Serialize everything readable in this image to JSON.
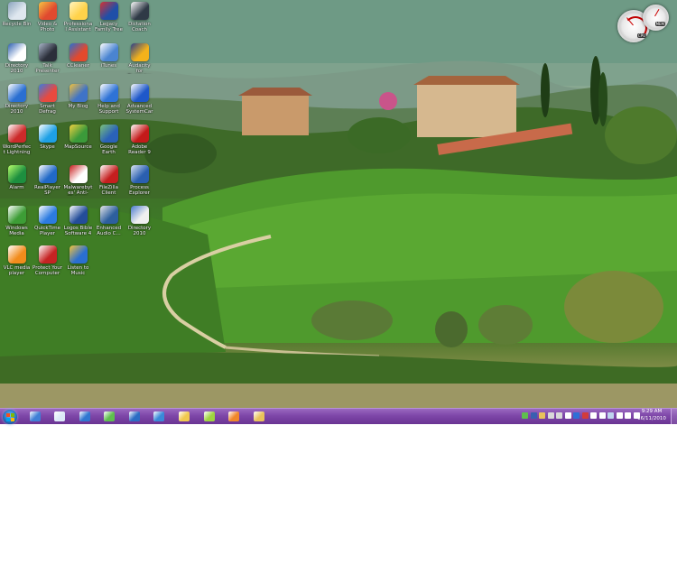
{
  "desktop": {
    "icons": [
      {
        "label": "Recycle Bin",
        "icon": "recycle-bin-icon",
        "color": "#dfe7ef",
        "accent": "#8aa3bd"
      },
      {
        "label": "Video & Photo",
        "icon": "media-icon",
        "color": "#e04a2f",
        "accent": "#f6c343"
      },
      {
        "label": "Professional Assistant",
        "icon": "professional-icon",
        "color": "#ffd24a",
        "accent": "#fff4c2"
      },
      {
        "label": "Legacy Family Tree",
        "icon": "legacy-icon",
        "color": "#1f4fa8",
        "accent": "#d43333"
      },
      {
        "label": "Dictation Coach",
        "icon": "dictation-icon",
        "color": "#2f3a46",
        "accent": "#ffffff"
      },
      {
        "label": "Directory 2010",
        "icon": "directory-doc-icon",
        "color": "#ffffff",
        "accent": "#2d5fb0"
      },
      {
        "label": "Talk Presenter",
        "icon": "talk-icon",
        "color": "#2b2f3a",
        "accent": "#a9b5c9"
      },
      {
        "label": "CCleaner",
        "icon": "ccleaner-icon",
        "color": "#e2492d",
        "accent": "#2a6fd1"
      },
      {
        "label": "iTunes",
        "icon": "itunes-icon",
        "color": "#4a84d1",
        "accent": "#ffffff"
      },
      {
        "label": "Audacity for Dummies",
        "icon": "audacity-icon",
        "color": "#f3b21b",
        "accent": "#2b3f8a"
      },
      {
        "label": "Directory 2010",
        "icon": "directory-pen-icon",
        "color": "#2a6fd1",
        "accent": "#ffffff"
      },
      {
        "label": "Smart Defrag",
        "icon": "defrag-icon",
        "color": "#e84a3f",
        "accent": "#3b7be0"
      },
      {
        "label": "My Blog",
        "icon": "blog-icon",
        "color": "#3f73c7",
        "accent": "#f2c13b"
      },
      {
        "label": "Help and Support",
        "icon": "help-icon",
        "color": "#2f73d6",
        "accent": "#ffffff"
      },
      {
        "label": "Advanced SystemCare",
        "icon": "systemcare-icon",
        "color": "#1e58c9",
        "accent": "#ffffff"
      },
      {
        "label": "WordPerfect Lightning",
        "icon": "wordperfect-icon",
        "color": "#cc2a2a",
        "accent": "#ffffff"
      },
      {
        "label": "Skype",
        "icon": "skype-icon",
        "color": "#1ea0e6",
        "accent": "#ffffff"
      },
      {
        "label": "MapSource",
        "icon": "mapsource-icon",
        "color": "#3b9a3a",
        "accent": "#f0d040"
      },
      {
        "label": "Google Earth",
        "icon": "google-earth-icon",
        "color": "#2a62b8",
        "accent": "#7cc17a"
      },
      {
        "label": "Adobe Reader 9",
        "icon": "adobe-reader-icon",
        "color": "#c41a1a",
        "accent": "#ffffff"
      },
      {
        "label": "Alarm",
        "icon": "alarm-icon",
        "color": "#1d8f3f",
        "accent": "#b8ff6b"
      },
      {
        "label": "RealPlayer SP",
        "icon": "realplayer-icon",
        "color": "#2169c7",
        "accent": "#ffffff"
      },
      {
        "label": "Malwarebytes' Anti-Malware",
        "icon": "malwarebytes-icon",
        "color": "#ffffff",
        "accent": "#c91d1d"
      },
      {
        "label": "FileZilla Client",
        "icon": "filezilla-icon",
        "color": "#c51f1f",
        "accent": "#ffffff"
      },
      {
        "label": "Process Explorer",
        "icon": "tools-icon",
        "color": "#2a5fb0",
        "accent": "#dde6f2"
      },
      {
        "label": "Windows Media Center",
        "icon": "media-center-icon",
        "color": "#3d9d36",
        "accent": "#ffffff"
      },
      {
        "label": "QuickTime Player",
        "icon": "quicktime-icon",
        "color": "#2c7be0",
        "accent": "#ffffff"
      },
      {
        "label": "Logos Bible Software 4",
        "icon": "logos-icon",
        "color": "#244d9a",
        "accent": "#ffffff"
      },
      {
        "label": "Enhanced Audio C...",
        "icon": "audio-icon",
        "color": "#2d5f9e",
        "accent": "#e8e8e8"
      },
      {
        "label": "Directory 2010",
        "icon": "notes-doc-icon",
        "color": "#f0f0f0",
        "accent": "#4a7acf"
      },
      {
        "label": "VLC media player",
        "icon": "vlc-icon",
        "color": "#f28c1c",
        "accent": "#ffffff"
      },
      {
        "label": "Protect Your Computer",
        "icon": "shield-icon",
        "color": "#c62323",
        "accent": "#ffffff"
      },
      {
        "label": "Listen to Music",
        "icon": "music-icon",
        "color": "#2a6fd1",
        "accent": "#f4c43a"
      }
    ]
  },
  "gadgets": {
    "cpu_label": "CPU",
    "mem_label": "MEM"
  },
  "taskbar": {
    "color": "#7e47a8",
    "pinned": [
      {
        "icon": "explorer-icon",
        "color": "#3f7fd6"
      },
      {
        "icon": "notepad-icon",
        "color": "#dce9f7"
      },
      {
        "icon": "internet-explorer-icon",
        "color": "#2f77d1"
      },
      {
        "icon": "paint-icon",
        "color": "#5fbf4e"
      },
      {
        "icon": "magnifier-icon",
        "color": "#2b6cc4"
      },
      {
        "icon": "word-pen-icon",
        "color": "#3a8ad9"
      },
      {
        "icon": "folder-icon",
        "color": "#f1c94e"
      },
      {
        "icon": "green-app-icon",
        "color": "#9fd43f"
      },
      {
        "icon": "media-player-icon",
        "color": "#f0872a"
      },
      {
        "icon": "libraries-icon",
        "color": "#e9c25a"
      }
    ],
    "tray_icons": [
      "tray-network-icon",
      "tray-keyboard-icon",
      "tray-folder-icon",
      "tray-printer-icon",
      "tray-app-icon",
      "tray-shield-icon",
      "tray-bluetooth-icon",
      "tray-red-icon",
      "tray-app2-icon",
      "tray-flag-icon",
      "tray-monitor-icon",
      "tray-volume-icon",
      "tray-battery-icon",
      "tray-speaker-icon"
    ],
    "clock_time": "9:29 AM",
    "clock_date": "16/11/2010"
  }
}
